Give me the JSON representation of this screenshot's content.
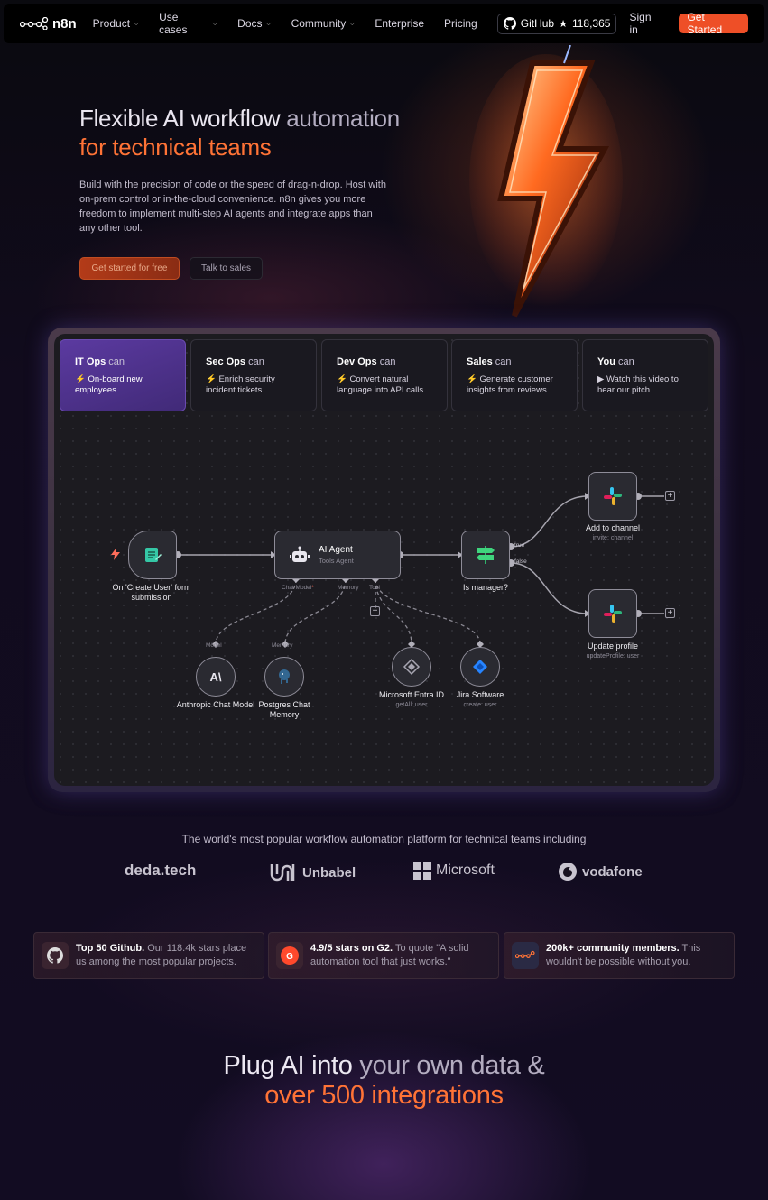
{
  "nav": {
    "logo": "n8n",
    "items": [
      {
        "label": "Product",
        "dropdown": true
      },
      {
        "label": "Use cases",
        "dropdown": true
      },
      {
        "label": "Docs",
        "dropdown": true
      },
      {
        "label": "Community",
        "dropdown": true
      },
      {
        "label": "Enterprise",
        "dropdown": false
      },
      {
        "label": "Pricing",
        "dropdown": false
      }
    ],
    "github_label": "GitHub",
    "github_stars": "118,365",
    "sign_in": "Sign in",
    "get_started": "Get Started"
  },
  "hero": {
    "title_part1": "Flexible AI workflow",
    "title_part2": " automation",
    "title_line2": "for technical teams",
    "description": "Build with the precision of code or the speed of drag-n-drop. Host with on-prem control or in-the-cloud convenience. n8n gives you more freedom to implement multi-step AI agents and integrate apps than any other tool.",
    "primary_button": "Get started for free",
    "secondary_button": "Talk to sales"
  },
  "tabs": [
    {
      "role": "IT Ops",
      "can": " can",
      "desc": "⚡ On-board new employees",
      "active": true
    },
    {
      "role": "Sec Ops",
      "can": " can",
      "desc": "⚡ Enrich security incident tickets",
      "active": false
    },
    {
      "role": "Dev Ops",
      "can": " can",
      "desc": "⚡ Convert natural language into API calls",
      "active": false
    },
    {
      "role": "Sales",
      "can": " can",
      "desc": "⚡ Generate customer insights from reviews",
      "active": false
    },
    {
      "role": "You",
      "can": " can",
      "desc": "▶ Watch this video to hear our pitch",
      "active": false
    }
  ],
  "workflow": {
    "trigger_label": "On 'Create User' form submission",
    "agent_label": "AI Agent",
    "agent_sub": "Tools Agent",
    "port_chat_model": "Chat Model",
    "port_chat_model_required": "*",
    "port_memory": "Memory",
    "port_tool": "Tool",
    "switch_label": "Is manager?",
    "switch_true": "true",
    "switch_false": "false",
    "add_channel_label": "Add to channel",
    "add_channel_sub": "invite: channel",
    "update_profile_label": "Update profile",
    "update_profile_sub": "updateProfile: user",
    "model_port": "Model",
    "memory_port": "Memory",
    "anthropic_label": "Anthropic Chat Model",
    "postgres_label": "Postgres Chat Memory",
    "entra_label": "Microsoft Entra ID",
    "entra_sub": "getAll: user",
    "jira_label": "Jira Software",
    "jira_sub": "create: user"
  },
  "trust": {
    "headline": "The world's most popular workflow automation platform for technical teams including",
    "brands": [
      "deda.tech",
      "Unbabel",
      "Microsoft",
      "vodafone"
    ]
  },
  "stats": [
    {
      "strong": "Top 50 Github.",
      "text": " Our 118.4k stars place us among the most popular projects.",
      "icon": "github-icon"
    },
    {
      "strong": "4.9/5 stars on G2.",
      "text": " To quote \"A solid automation tool that just works.\"",
      "icon": "g2-icon"
    },
    {
      "strong": "200k+ community members.",
      "text": " This wouldn't be possible without you.",
      "icon": "n8n-community-icon"
    }
  ],
  "bottom": {
    "part1": "Plug AI into",
    "part2": " your own data &",
    "line2": "over 500 integrations"
  },
  "colors": {
    "accent": "#ff7336",
    "cta": "#ee4f27",
    "active_tab": "#5b3aa0"
  }
}
